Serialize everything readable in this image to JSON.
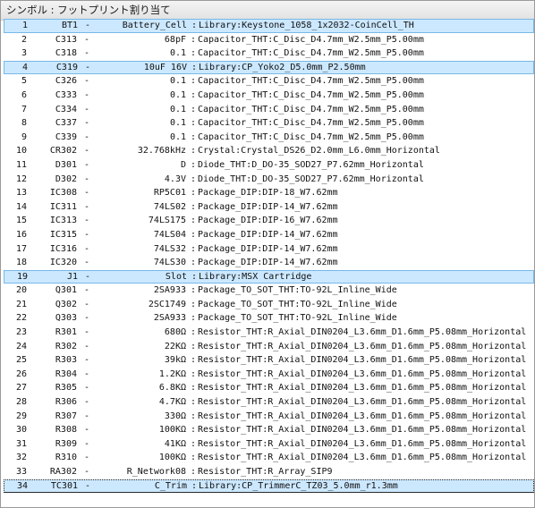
{
  "panel": {
    "title": "シンボル : フットプリント割り当て"
  },
  "separators": {
    "dash": "-",
    "colon": ":"
  },
  "rows": [
    {
      "num": "1",
      "ref": "BT1",
      "value": "Battery_Cell",
      "footprint": "Library:Keystone_1058_1x2032-CoinCell_TH",
      "highlighted": true
    },
    {
      "num": "2",
      "ref": "C313",
      "value": "68pF",
      "footprint": "Capacitor_THT:C_Disc_D4.7mm_W2.5mm_P5.00mm",
      "highlighted": false
    },
    {
      "num": "3",
      "ref": "C318",
      "value": "0.1",
      "footprint": "Capacitor_THT:C_Disc_D4.7mm_W2.5mm_P5.00mm",
      "highlighted": false
    },
    {
      "num": "4",
      "ref": "C319",
      "value": "10uF 16V",
      "footprint": "Library:CP_Yoko2_D5.0mm_P2.50mm",
      "highlighted": true
    },
    {
      "num": "5",
      "ref": "C326",
      "value": "0.1",
      "footprint": "Capacitor_THT:C_Disc_D4.7mm_W2.5mm_P5.00mm",
      "highlighted": false
    },
    {
      "num": "6",
      "ref": "C333",
      "value": "0.1",
      "footprint": "Capacitor_THT:C_Disc_D4.7mm_W2.5mm_P5.00mm",
      "highlighted": false
    },
    {
      "num": "7",
      "ref": "C334",
      "value": "0.1",
      "footprint": "Capacitor_THT:C_Disc_D4.7mm_W2.5mm_P5.00mm",
      "highlighted": false
    },
    {
      "num": "8",
      "ref": "C337",
      "value": "0.1",
      "footprint": "Capacitor_THT:C_Disc_D4.7mm_W2.5mm_P5.00mm",
      "highlighted": false
    },
    {
      "num": "9",
      "ref": "C339",
      "value": "0.1",
      "footprint": "Capacitor_THT:C_Disc_D4.7mm_W2.5mm_P5.00mm",
      "highlighted": false
    },
    {
      "num": "10",
      "ref": "CR302",
      "value": "32.768kHz",
      "footprint": "Crystal:Crystal_DS26_D2.0mm_L6.0mm_Horizontal",
      "highlighted": false
    },
    {
      "num": "11",
      "ref": "D301",
      "value": "D",
      "footprint": "Diode_THT:D_DO-35_SOD27_P7.62mm_Horizontal",
      "highlighted": false
    },
    {
      "num": "12",
      "ref": "D302",
      "value": "4.3V",
      "footprint": "Diode_THT:D_DO-35_SOD27_P7.62mm_Horizontal",
      "highlighted": false
    },
    {
      "num": "13",
      "ref": "IC308",
      "value": "RP5C01",
      "footprint": "Package_DIP:DIP-18_W7.62mm",
      "highlighted": false
    },
    {
      "num": "14",
      "ref": "IC311",
      "value": "74LS02",
      "footprint": "Package_DIP:DIP-14_W7.62mm",
      "highlighted": false
    },
    {
      "num": "15",
      "ref": "IC313",
      "value": "74LS175",
      "footprint": "Package_DIP:DIP-16_W7.62mm",
      "highlighted": false
    },
    {
      "num": "16",
      "ref": "IC315",
      "value": "74LS04",
      "footprint": "Package_DIP:DIP-14_W7.62mm",
      "highlighted": false
    },
    {
      "num": "17",
      "ref": "IC316",
      "value": "74LS32",
      "footprint": "Package_DIP:DIP-14_W7.62mm",
      "highlighted": false
    },
    {
      "num": "18",
      "ref": "IC320",
      "value": "74LS30",
      "footprint": "Package_DIP:DIP-14_W7.62mm",
      "highlighted": false
    },
    {
      "num": "19",
      "ref": "J1",
      "value": "Slot",
      "footprint": "Library:MSX Cartridge",
      "highlighted": true
    },
    {
      "num": "20",
      "ref": "Q301",
      "value": "2SA933",
      "footprint": "Package_TO_SOT_THT:TO-92L_Inline_Wide",
      "highlighted": false
    },
    {
      "num": "21",
      "ref": "Q302",
      "value": "2SC1749",
      "footprint": "Package_TO_SOT_THT:TO-92L_Inline_Wide",
      "highlighted": false
    },
    {
      "num": "22",
      "ref": "Q303",
      "value": "2SA933",
      "footprint": "Package_TO_SOT_THT:TO-92L_Inline_Wide",
      "highlighted": false
    },
    {
      "num": "23",
      "ref": "R301",
      "value": "680Ω",
      "footprint": "Resistor_THT:R_Axial_DIN0204_L3.6mm_D1.6mm_P5.08mm_Horizontal",
      "highlighted": false
    },
    {
      "num": "24",
      "ref": "R302",
      "value": "22KΩ",
      "footprint": "Resistor_THT:R_Axial_DIN0204_L3.6mm_D1.6mm_P5.08mm_Horizontal",
      "highlighted": false
    },
    {
      "num": "25",
      "ref": "R303",
      "value": "39kΩ",
      "footprint": "Resistor_THT:R_Axial_DIN0204_L3.6mm_D1.6mm_P5.08mm_Horizontal",
      "highlighted": false
    },
    {
      "num": "26",
      "ref": "R304",
      "value": "1.2KΩ",
      "footprint": "Resistor_THT:R_Axial_DIN0204_L3.6mm_D1.6mm_P5.08mm_Horizontal",
      "highlighted": false
    },
    {
      "num": "27",
      "ref": "R305",
      "value": "6.8KΩ",
      "footprint": "Resistor_THT:R_Axial_DIN0204_L3.6mm_D1.6mm_P5.08mm_Horizontal",
      "highlighted": false
    },
    {
      "num": "28",
      "ref": "R306",
      "value": "4.7KΩ",
      "footprint": "Resistor_THT:R_Axial_DIN0204_L3.6mm_D1.6mm_P5.08mm_Horizontal",
      "highlighted": false
    },
    {
      "num": "29",
      "ref": "R307",
      "value": "330Ω",
      "footprint": "Resistor_THT:R_Axial_DIN0204_L3.6mm_D1.6mm_P5.08mm_Horizontal",
      "highlighted": false
    },
    {
      "num": "30",
      "ref": "R308",
      "value": "100KΩ",
      "footprint": "Resistor_THT:R_Axial_DIN0204_L3.6mm_D1.6mm_P5.08mm_Horizontal",
      "highlighted": false
    },
    {
      "num": "31",
      "ref": "R309",
      "value": "41KΩ",
      "footprint": "Resistor_THT:R_Axial_DIN0204_L3.6mm_D1.6mm_P5.08mm_Horizontal",
      "highlighted": false
    },
    {
      "num": "32",
      "ref": "R310",
      "value": "100KΩ",
      "footprint": "Resistor_THT:R_Axial_DIN0204_L3.6mm_D1.6mm_P5.08mm_Horizontal",
      "highlighted": false
    },
    {
      "num": "33",
      "ref": "RA302",
      "value": "R_Network08",
      "footprint": "Resistor_THT:R_Array_SIP9",
      "highlighted": false
    },
    {
      "num": "34",
      "ref": "TC301",
      "value": "C_Trim",
      "footprint": "Library:CP_TrimmerC_TZ03_5.0mm_r1.3mm",
      "highlighted": true,
      "focused": true
    }
  ]
}
